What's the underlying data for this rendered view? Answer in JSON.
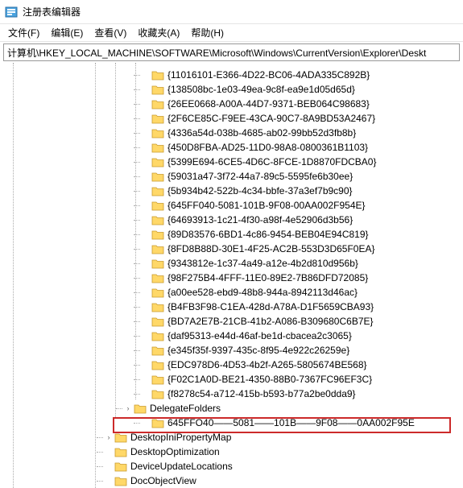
{
  "window": {
    "title": "注册表编辑器"
  },
  "menu": {
    "file": "文件(F)",
    "edit": "编辑(E)",
    "view": "查看(V)",
    "favorites": "收藏夹(A)",
    "help": "帮助(H)"
  },
  "address": {
    "path": "计算机\\HKEY_LOCAL_MACHINE\\SOFTWARE\\Microsoft\\Windows\\CurrentVersion\\Explorer\\Deskt"
  },
  "tree": {
    "guid_items": [
      "{11016101-E366-4D22-BC06-4ADA335C892B}",
      "{138508bc-1e03-49ea-9c8f-ea9e1d05d65d}",
      "{26EE0668-A00A-44D7-9371-BEB064C98683}",
      "{2F6CE85C-F9EE-43CA-90C7-8A9BD53A2467}",
      "{4336a54d-038b-4685-ab02-99bb52d3fb8b}",
      "{450D8FBA-AD25-11D0-98A8-0800361B1103}",
      "{5399E694-6CE5-4D6C-8FCE-1D8870FDCBA0}",
      "{59031a47-3f72-44a7-89c5-5595fe6b30ee}",
      "{5b934b42-522b-4c34-bbfe-37a3ef7b9c90}",
      "{645FF040-5081-101B-9F08-00AA002F954E}",
      "{64693913-1c21-4f30-a98f-4e52906d3b56}",
      "{89D83576-6BD1-4c86-9454-BEB04E94C819}",
      "{8FD8B88D-30E1-4F25-AC2B-553D3D65F0EA}",
      "{9343812e-1c37-4a49-a12e-4b2d810d956b}",
      "{98F275B4-4FFF-11E0-89E2-7B86DFD72085}",
      "{a00ee528-ebd9-48b8-944a-8942113d46ac}",
      "{B4FB3F98-C1EA-428d-A78A-D1F5659CBA93}",
      "{BD7A2E7B-21CB-41b2-A086-B309680C6B7E}",
      "{daf95313-e44d-46af-be1d-cbacea2c3065}",
      "{e345f35f-9397-435c-8f95-4e922c26259e}",
      "{EDC978D6-4D53-4b2f-A265-5805674BE568}",
      "{F02C1A0D-BE21-4350-88B0-7367FC96EF3C}",
      "{f8278c54-a712-415b-b593-b77a2be0dda9}"
    ],
    "delegate_folders": "DelegateFolders",
    "highlighted_item": "645FFO40——5081——101B——9F08——0AA002F95E",
    "desktop_ini": "DesktopIniPropertyMap",
    "desktop_opt": "DesktopOptimization",
    "device_update": "DeviceUpdateLocations",
    "doc_object": "DocObjectView"
  },
  "icons": {
    "app": "regedit-icon",
    "folder": "folder-icon",
    "expander_collapsed": "chevron-right-icon"
  },
  "colors": {
    "highlight_border": "#cc2a2a",
    "folder_fill": "#ffd868",
    "folder_stroke": "#c99a2e"
  }
}
